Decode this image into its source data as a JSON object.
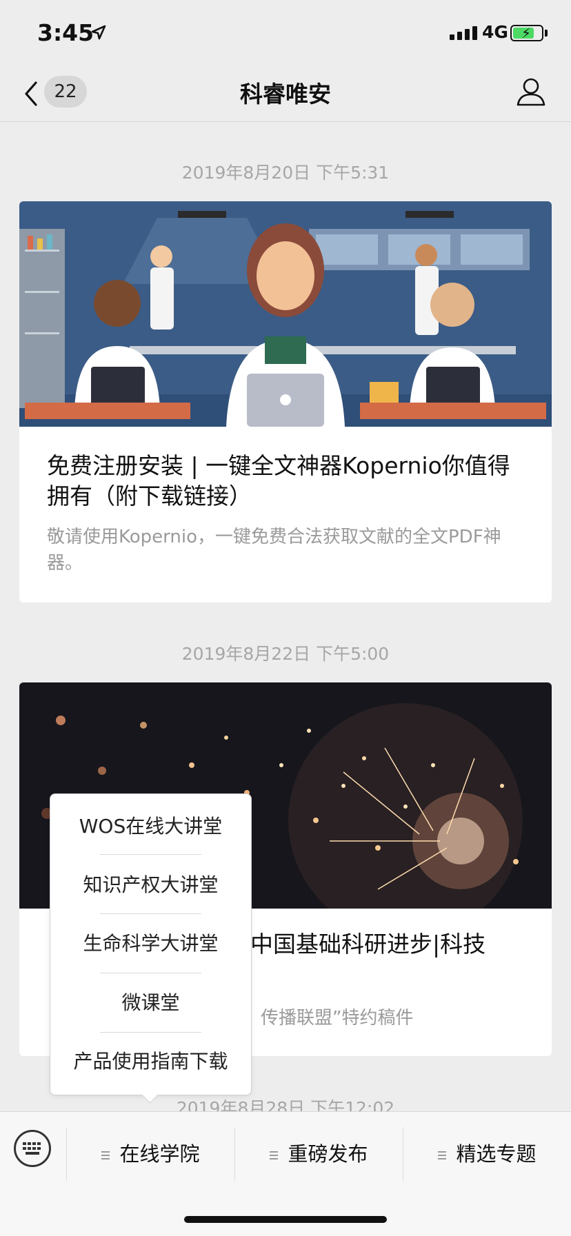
{
  "status": {
    "time": "3:45",
    "network": "4G"
  },
  "nav": {
    "unread_count": "22",
    "title": "科睿唯安"
  },
  "feed": [
    {
      "date": "2019年8月20日 下午5:31",
      "title": "免费注册安装 | 一键全文神器Kopernio你值得拥有（附下载链接）",
      "desc": "敬请使用Kopernio，一键免费合法获取文献的全文PDF神器。"
    },
    {
      "date": "2019年8月22日 下午5:00",
      "title_visible": "中国基础科研进步|科技",
      "desc_visible": "传播联盟”特约稿件"
    },
    {
      "date": "2019年8月28日 下午12:02"
    }
  ],
  "popup": {
    "items": [
      "WOS在线大讲堂",
      "知识产权大讲堂",
      "生命科学大讲堂",
      "微课堂",
      "产品使用指南下载"
    ]
  },
  "menu": {
    "items": [
      "在线学院",
      "重磅发布",
      "精选专题"
    ]
  },
  "colors": {
    "accent_green": "#4cd964",
    "background": "#ededed"
  }
}
